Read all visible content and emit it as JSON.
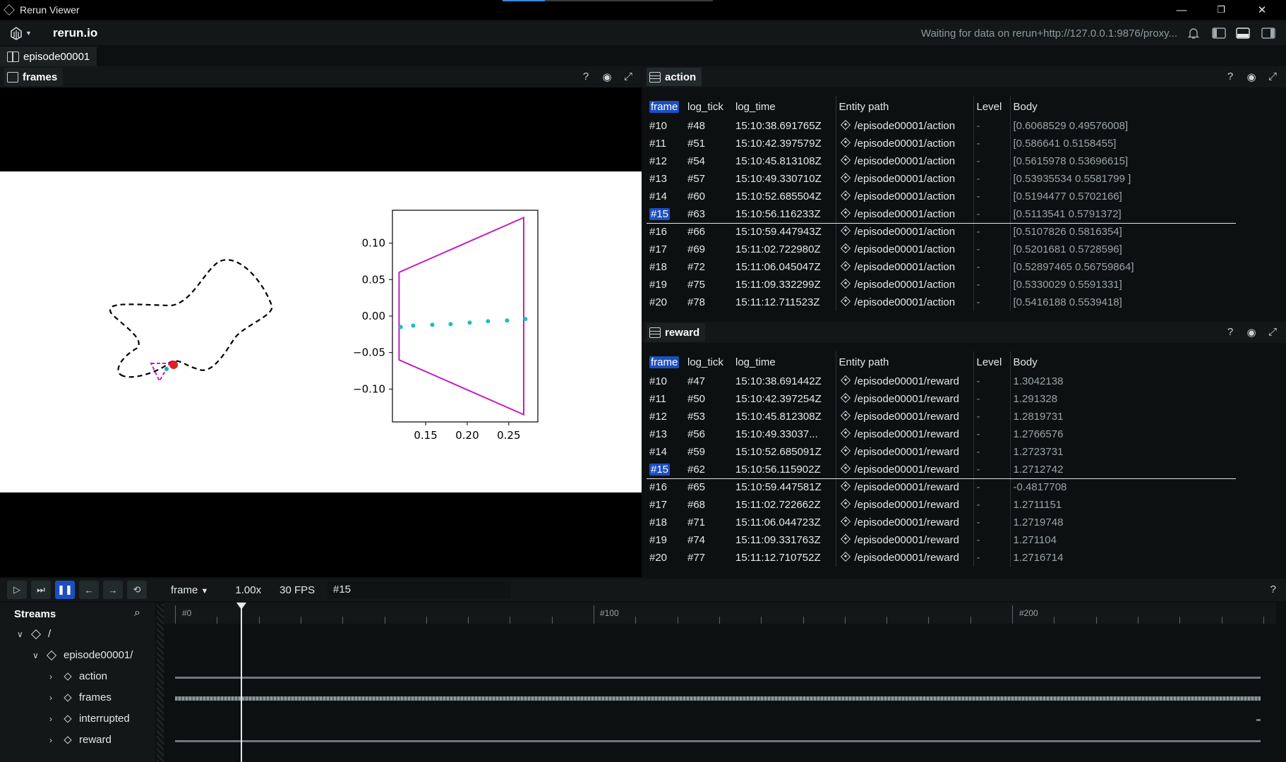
{
  "os": {
    "title": "Rerun Viewer",
    "minimize": "—",
    "restore": "❐",
    "close": "✕"
  },
  "top": {
    "app_name": "rerun.io",
    "status": "Waiting for data on rerun+http://127.0.0.1:9876/proxy..."
  },
  "recording": {
    "label": "episode00001"
  },
  "frames_panel": {
    "title": "frames",
    "help": "?",
    "eye": "👁",
    "expand": "⤢"
  },
  "chart_data": {
    "type": "line",
    "yticks": [
      "0.10",
      "0.05",
      "0.00",
      "−0.05",
      "−0.10"
    ],
    "xticks": [
      "0.15",
      "0.20",
      "0.25"
    ],
    "series": [
      {
        "values": [
          [
            0.118,
            0.06
          ],
          [
            0.268,
            0.135
          ],
          [
            0.268,
            -0.135
          ],
          [
            0.118,
            -0.06
          ],
          [
            0.118,
            0.06
          ]
        ],
        "color": "#c020c0"
      },
      {
        "values": [
          [
            0.12,
            -0.015
          ],
          [
            0.135,
            -0.013
          ],
          [
            0.158,
            -0.012
          ],
          [
            0.18,
            -0.011
          ],
          [
            0.203,
            -0.009
          ],
          [
            0.225,
            -0.007
          ],
          [
            0.248,
            -0.006
          ],
          [
            0.27,
            -0.004
          ]
        ],
        "color": "#17c0c0"
      }
    ]
  },
  "action_panel": {
    "title": "action",
    "columns": [
      "frame",
      "log_tick",
      "log_time",
      "Entity path",
      "Level",
      "Body"
    ],
    "rows": [
      [
        "#10",
        "#48",
        "15:10:38.691765Z",
        "/episode00001/action",
        "-",
        "[0.6068529  0.49576008]"
      ],
      [
        "#11",
        "#51",
        "15:10:42.397579Z",
        "/episode00001/action",
        "-",
        "[0.586641  0.5158455]"
      ],
      [
        "#12",
        "#54",
        "15:10:45.813108Z",
        "/episode00001/action",
        "-",
        "[0.5615978  0.53696615]"
      ],
      [
        "#13",
        "#57",
        "15:10:49.330710Z",
        "/episode00001/action",
        "-",
        "[0.53935534 0.5581799 ]"
      ],
      [
        "#14",
        "#60",
        "15:10:52.685504Z",
        "/episode00001/action",
        "-",
        "[0.5194477 0.5702166]"
      ],
      [
        "#15",
        "#63",
        "15:10:56.116233Z",
        "/episode00001/action",
        "-",
        "[0.5113541 0.5791372]"
      ],
      [
        "#16",
        "#66",
        "15:10:59.447943Z",
        "/episode00001/action",
        "-",
        "[0.5107826 0.5816354]"
      ],
      [
        "#17",
        "#69",
        "15:11:02.722980Z",
        "/episode00001/action",
        "-",
        "[0.5201681 0.5728596]"
      ],
      [
        "#18",
        "#72",
        "15:11:06.045047Z",
        "/episode00001/action",
        "-",
        "[0.52897465 0.56759864]"
      ],
      [
        "#19",
        "#75",
        "15:11:09.332299Z",
        "/episode00001/action",
        "-",
        "[0.5330029 0.5591331]"
      ],
      [
        "#20",
        "#78",
        "15:11:12.711523Z",
        "/episode00001/action",
        "-",
        "[0.5416188 0.5539418]"
      ]
    ]
  },
  "reward_panel": {
    "title": "reward",
    "columns": [
      "frame",
      "log_tick",
      "log_time",
      "Entity path",
      "Level",
      "Body"
    ],
    "rows": [
      [
        "#10",
        "#47",
        "15:10:38.691442Z",
        "/episode00001/reward",
        "-",
        "1.3042138"
      ],
      [
        "#11",
        "#50",
        "15:10:42.397254Z",
        "/episode00001/reward",
        "-",
        "1.291328"
      ],
      [
        "#12",
        "#53",
        "15:10:45.812308Z",
        "/episode00001/reward",
        "-",
        "1.2819731"
      ],
      [
        "#13",
        "#56",
        "15:10:49.33037...",
        "/episode00001/reward",
        "-",
        "1.2766576"
      ],
      [
        "#14",
        "#59",
        "15:10:52.685091Z",
        "/episode00001/reward",
        "-",
        "1.2723731"
      ],
      [
        "#15",
        "#62",
        "15:10:56.115902Z",
        "/episode00001/reward",
        "-",
        "1.2712742"
      ],
      [
        "#16",
        "#65",
        "15:10:59.447581Z",
        "/episode00001/reward",
        "-",
        "-0.4817708"
      ],
      [
        "#17",
        "#68",
        "15:11:02.722662Z",
        "/episode00001/reward",
        "-",
        "1.2711151"
      ],
      [
        "#18",
        "#71",
        "15:11:06.044723Z",
        "/episode00001/reward",
        "-",
        "1.2719748"
      ],
      [
        "#19",
        "#74",
        "15:11:09.331763Z",
        "/episode00001/reward",
        "-",
        "1.271104"
      ],
      [
        "#20",
        "#77",
        "15:11:12.710752Z",
        "/episode00001/reward",
        "-",
        "1.2716714"
      ]
    ]
  },
  "time_panel": {
    "timeline": "frame",
    "speed": "1.00x",
    "fps": "30 FPS",
    "current": "#15",
    "help": "?",
    "ticks": [
      "#0",
      "#100",
      "#200"
    ]
  },
  "streams": {
    "title": "Streams",
    "items": [
      "/",
      "episode00001/",
      "action",
      "frames",
      "interrupted",
      "reward"
    ]
  }
}
